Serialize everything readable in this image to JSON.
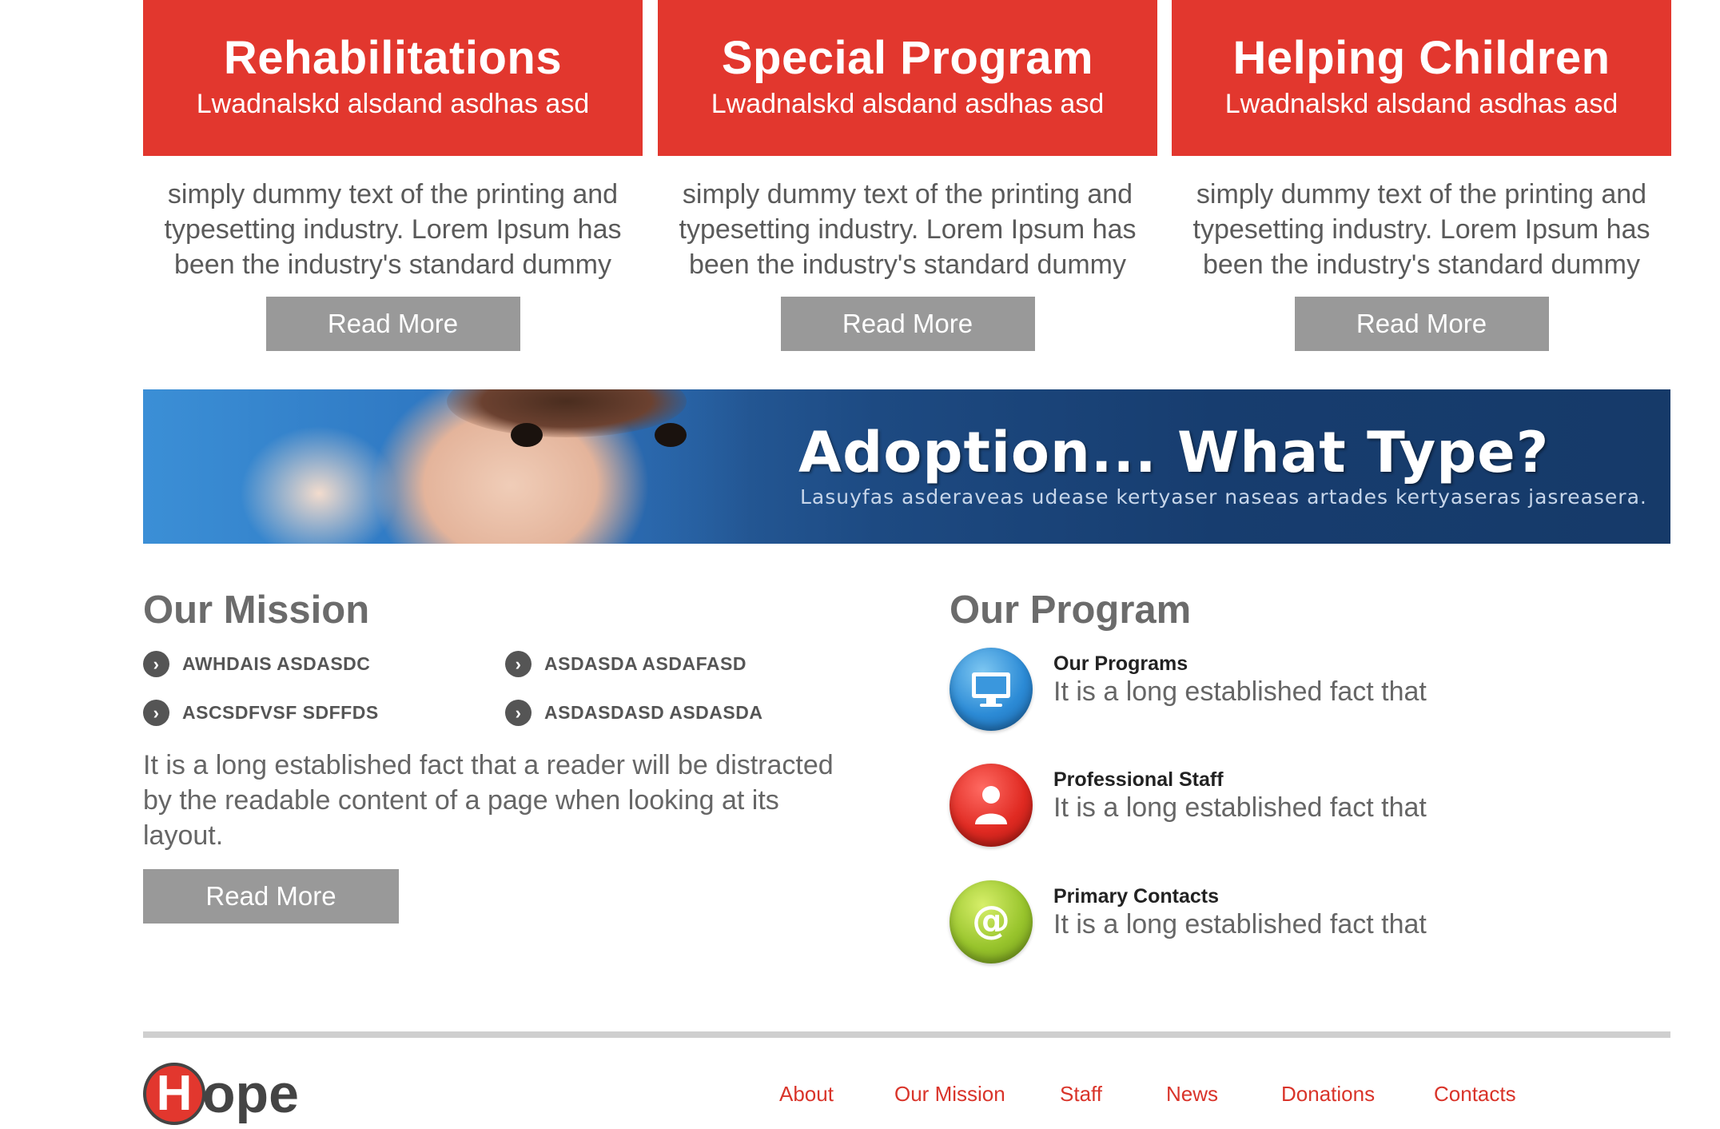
{
  "cards": [
    {
      "title": "Rehabilitations",
      "subtitle": "Lwadnalskd alsdand asdhas asd",
      "text": "simply dummy text of the printing and typesetting industry. Lorem Ipsum has been the industry's standard dummy",
      "button": "Read More"
    },
    {
      "title": "Special Program",
      "subtitle": "Lwadnalskd alsdand asdhas asd",
      "text": "simply dummy text of the printing and typesetting industry. Lorem Ipsum has been the industry's standard dummy",
      "button": "Read More"
    },
    {
      "title": "Helping Children",
      "subtitle": "Lwadnalskd alsdand asdhas asd",
      "text": "simply dummy text of the printing and typesetting industry. Lorem Ipsum has been the industry's standard dummy",
      "button": "Read More"
    }
  ],
  "banner": {
    "title": "Adoption... What Type?",
    "subtitle": "Lasuyfas asderaveas udease kertyaser naseas artades kertyaseras jasreasera."
  },
  "mission": {
    "title": "Our Mission",
    "bullets": [
      "AWHDAIS ASDASDC",
      "ASDASDA ASDAFASD",
      "ASCSDFVSF SDFFDS",
      "ASDASDASD ASDASDA"
    ],
    "text": "It is a long established fact that a reader will be distracted by the readable content of a page when looking at its layout.",
    "button": "Read More"
  },
  "program": {
    "title": "Our Program",
    "items": [
      {
        "name": "Our Programs",
        "desc": "It is a long established fact that",
        "icon": "monitor-icon"
      },
      {
        "name": "Professional Staff",
        "desc": "It is a long established fact that",
        "icon": "user-icon"
      },
      {
        "name": "Primary Contacts",
        "desc": "It is a long established fact that",
        "icon": "at-sign-icon"
      }
    ]
  },
  "footer": {
    "logo_letter": "H",
    "logo_rest": "ope",
    "nav": [
      "About",
      "Our Mission",
      "Staff",
      "News",
      "Donations",
      "Contacts"
    ]
  },
  "colors": {
    "accent": "#e2372e",
    "button": "#999999",
    "banner": "#163a69"
  }
}
